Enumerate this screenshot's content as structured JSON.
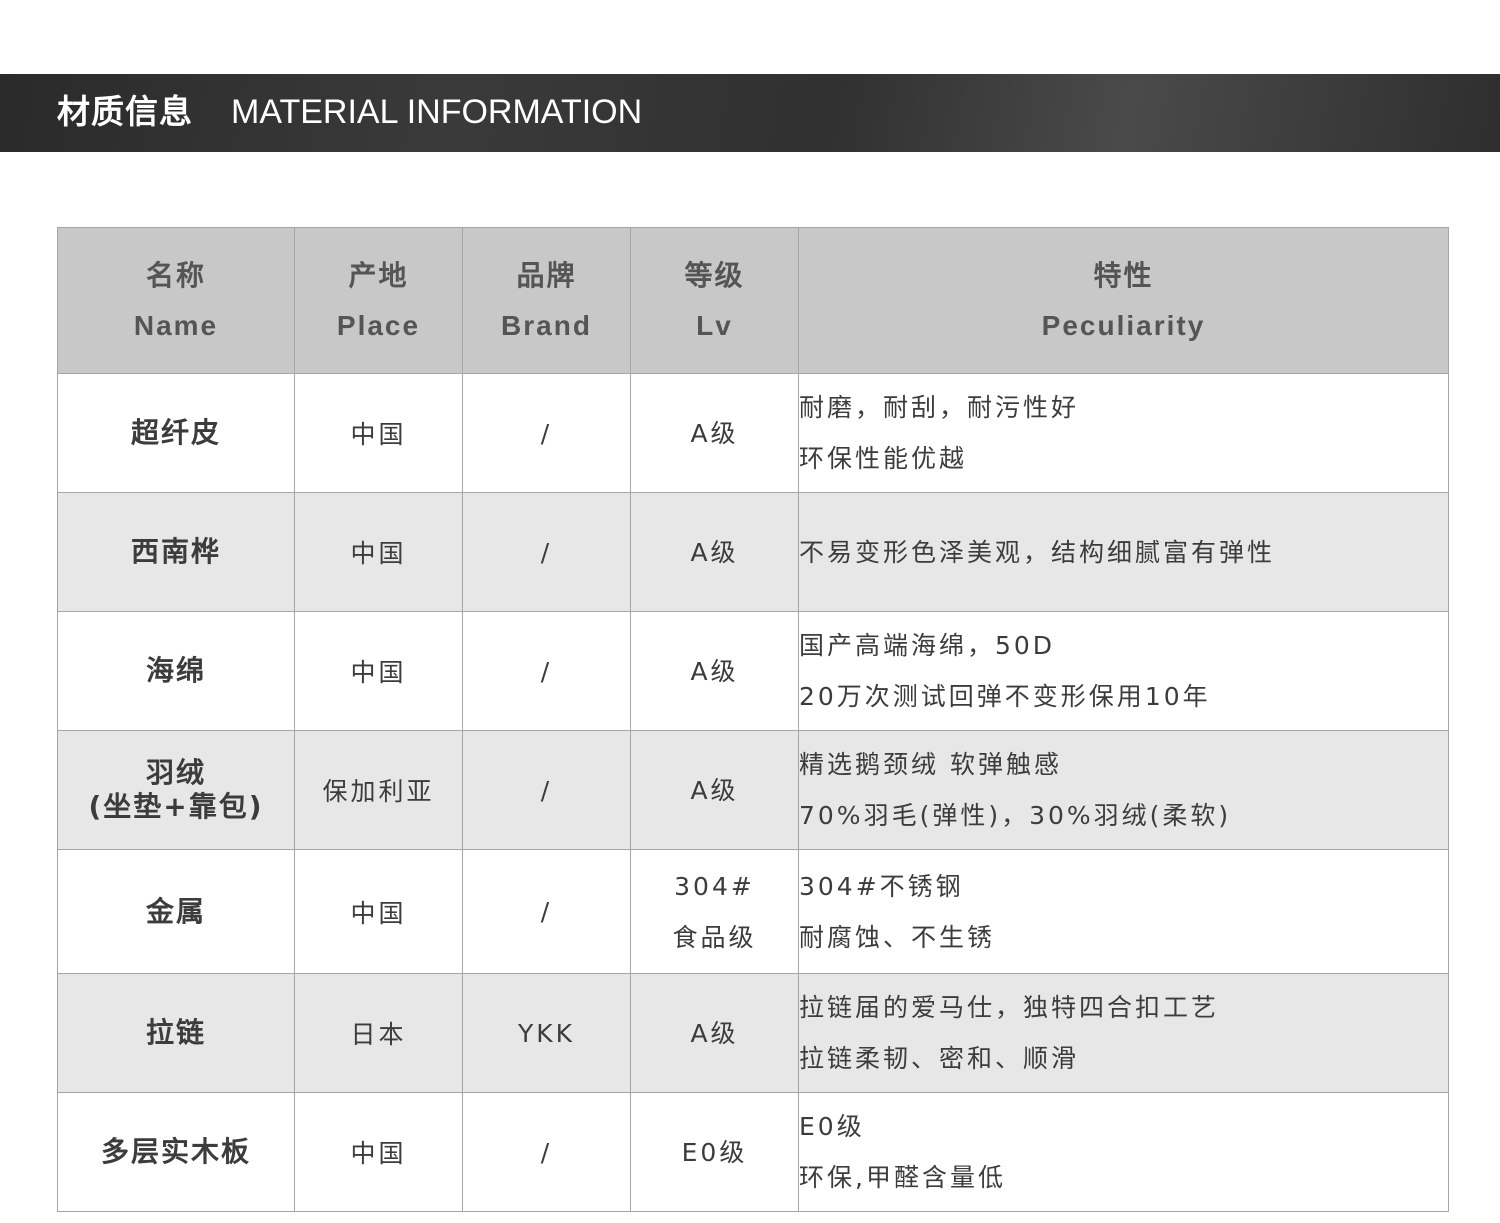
{
  "header": {
    "title_cn": "材质信息",
    "title_en": "MATERIAL INFORMATION"
  },
  "table": {
    "columns": [
      {
        "cn": "名称",
        "en": "Name"
      },
      {
        "cn": "产地",
        "en": "Place"
      },
      {
        "cn": "品牌",
        "en": "Brand"
      },
      {
        "cn": "等级",
        "en": "Lv"
      },
      {
        "cn": "特性",
        "en": "Peculiarity"
      }
    ],
    "rows": [
      {
        "name": [
          "超纤皮"
        ],
        "place": "中国",
        "brand": "/",
        "lv": [
          "A级"
        ],
        "features": [
          "耐磨，耐刮，耐污性好",
          "环保性能优越"
        ]
      },
      {
        "name": [
          "西南桦"
        ],
        "place": "中国",
        "brand": "/",
        "lv": [
          "A级"
        ],
        "features": [
          "不易变形色泽美观，结构细腻富有弹性"
        ]
      },
      {
        "name": [
          "海绵"
        ],
        "place": "中国",
        "brand": "/",
        "lv": [
          "A级"
        ],
        "features": [
          "国产高端海绵，50D",
          "20万次测试回弹不变形保用10年"
        ]
      },
      {
        "name": [
          "羽绒",
          "(坐垫+靠包)"
        ],
        "place": "保加利亚",
        "brand": "/",
        "lv": [
          "A级"
        ],
        "features": [
          "精选鹅颈绒 软弹触感",
          "70%羽毛(弹性)，30%羽绒(柔软)"
        ]
      },
      {
        "name": [
          "金属"
        ],
        "place": "中国",
        "brand": "/",
        "lv": [
          "304#",
          "食品级"
        ],
        "features": [
          "304#不锈钢",
          "耐腐蚀、不生锈"
        ]
      },
      {
        "name": [
          "拉链"
        ],
        "place": "日本",
        "brand": "YKK",
        "lv": [
          "A级"
        ],
        "features": [
          "拉链届的爱马仕，独特四合扣工艺",
          "拉链柔韧、密和、顺滑"
        ]
      },
      {
        "name": [
          "多层实木板"
        ],
        "place": "中国",
        "brand": "/",
        "lv": [
          "E0级"
        ],
        "features": [
          "E0级",
          "环保,甲醛含量低"
        ]
      }
    ]
  }
}
